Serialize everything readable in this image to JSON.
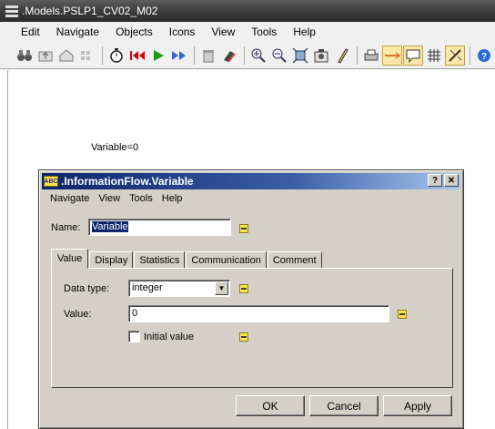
{
  "window": {
    "title": ".Models.PSLP1_CV02_M02",
    "menu": [
      "Edit",
      "Navigate",
      "Objects",
      "Icons",
      "View",
      "Tools",
      "Help"
    ],
    "toolbar_icons": [
      "binoculars-icon",
      "up-folder-icon",
      "home-icon",
      "grid-disabled-icon",
      "stopwatch-icon",
      "reset-icon",
      "start-icon",
      "fast-forward-icon",
      "trash-icon",
      "eraser-icon",
      "zoom-in-icon",
      "zoom-out-icon",
      "zoom-fit-icon",
      "camera-icon",
      "pencil-icon",
      "printer-icon",
      "connector-icon",
      "speech-bubble-icon",
      "grid-icon",
      "wizard-icon",
      "help-icon"
    ]
  },
  "canvas": {
    "label": "Variable=0"
  },
  "dialog": {
    "icon_text": "ABC",
    "title": ".InformationFlow.Variable",
    "help_glyph": "?",
    "close_glyph": "✕",
    "menu": [
      "Navigate",
      "View",
      "Tools",
      "Help"
    ],
    "name_label": "Name:",
    "name_value": "Variable",
    "tabs": [
      "Value",
      "Display",
      "Statistics",
      "Communication",
      "Comment"
    ],
    "selected_tab": "Value",
    "data_type_label": "Data type:",
    "data_type_value": "integer",
    "value_label": "Value:",
    "value_value": "0",
    "initial_value_label": "Initial value",
    "initial_value_checked": false,
    "buttons": {
      "ok": "OK",
      "cancel": "Cancel",
      "apply": "Apply"
    }
  }
}
